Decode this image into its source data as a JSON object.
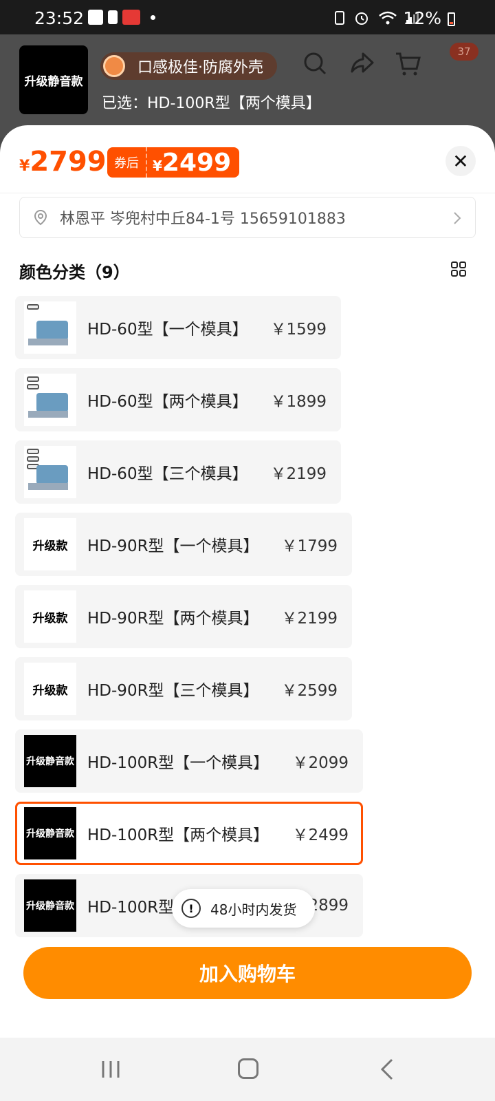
{
  "status_bar": {
    "time": "23:52",
    "battery": "12%"
  },
  "header": {
    "thumb_label": "升级静音款",
    "badge_text": "口感极佳·防腐外壳",
    "cart_count": "37",
    "selected_text": "已选：HD-100R型【两个模具】"
  },
  "price": {
    "currency": "¥",
    "original": "2799",
    "coupon_tag": "券后",
    "coupon_currency": "¥",
    "after_coupon": "2499"
  },
  "address": {
    "text": "林恩平 岑兜村中丘84-1号 15659101883"
  },
  "section": {
    "title": "颜色分类（9）"
  },
  "options": [
    {
      "name": "HD-60型【一个模具】",
      "price": "￥1599",
      "thumb": "machine",
      "thumb_label": "",
      "molds": 1
    },
    {
      "name": "HD-60型【两个模具】",
      "price": "￥1899",
      "thumb": "machine",
      "thumb_label": "",
      "molds": 2
    },
    {
      "name": "HD-60型【三个模具】",
      "price": "￥2199",
      "thumb": "machine",
      "thumb_label": "",
      "molds": 3
    },
    {
      "name": "HD-90R型【一个模具】",
      "price": "￥1799",
      "thumb": "white",
      "thumb_label": "升级款"
    },
    {
      "name": "HD-90R型【两个模具】",
      "price": "￥2199",
      "thumb": "white",
      "thumb_label": "升级款"
    },
    {
      "name": "HD-90R型【三个模具】",
      "price": "￥2599",
      "thumb": "white",
      "thumb_label": "升级款"
    },
    {
      "name": "HD-100R型【一个模具】",
      "price": "￥2099",
      "thumb": "black",
      "thumb_label": "升级静音款"
    },
    {
      "name": "HD-100R型【两个模具】",
      "price": "￥2499",
      "thumb": "black",
      "thumb_label": "升级静音款",
      "selected": true
    },
    {
      "name": "HD-100R型",
      "price": "2899",
      "thumb": "black",
      "thumb_label": "升级静音款"
    }
  ],
  "toast": {
    "text": "48小时内发货"
  },
  "actions": {
    "add_to_cart": "加入购物车"
  },
  "colors": {
    "accent": "#ff5000",
    "button": "#ff8c00"
  }
}
